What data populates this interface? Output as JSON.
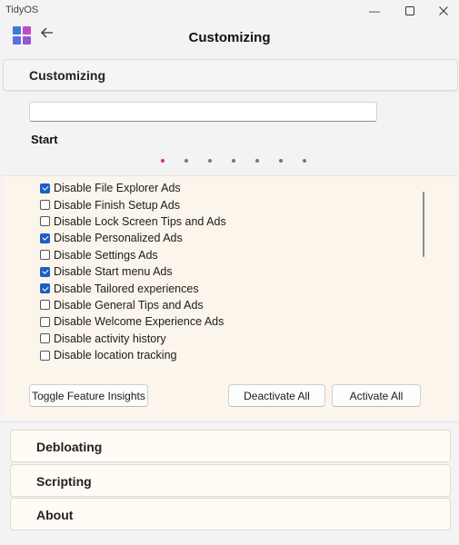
{
  "window": {
    "title": "TidyOS",
    "controls": {
      "minimize_icon": "minimize-icon",
      "maximize_icon": "maximize-icon",
      "close_icon": "close-icon"
    }
  },
  "header": {
    "title": "Customizing",
    "back_icon": "back-arrow-icon",
    "logo_colors": [
      "#3e7bd8",
      "#c24bc6",
      "#5a6ee0",
      "#8e5ad0"
    ]
  },
  "expander": {
    "label": "Customizing"
  },
  "search": {
    "value": "",
    "placeholder": ""
  },
  "section": {
    "title": "Start"
  },
  "pager": {
    "count": 7,
    "active_index": 0,
    "active_color": "#e0208e",
    "inactive_color": "#777777"
  },
  "features": [
    {
      "label": "Disable File Explorer Ads",
      "checked": true
    },
    {
      "label": "Disable Finish Setup Ads",
      "checked": false
    },
    {
      "label": "Disable Lock Screen Tips and Ads",
      "checked": false
    },
    {
      "label": "Disable Personalized Ads",
      "checked": true
    },
    {
      "label": "Disable Settings Ads",
      "checked": false
    },
    {
      "label": "Disable Start menu Ads",
      "checked": true
    },
    {
      "label": "Disable Tailored experiences",
      "checked": true
    },
    {
      "label": "Disable General Tips and Ads",
      "checked": false
    },
    {
      "label": "Disable Welcome Experience Ads",
      "checked": false
    },
    {
      "label": "Disable activity history",
      "checked": false
    },
    {
      "label": "Disable location tracking",
      "checked": false
    }
  ],
  "buttons": {
    "toggle_insights": "Toggle Feature Insights",
    "deactivate_all": "Deactivate All",
    "activate_all": "Activate All"
  },
  "sections": [
    {
      "label": "Debloating"
    },
    {
      "label": "Scripting"
    },
    {
      "label": "About"
    }
  ],
  "colors": {
    "accent": "#1a5fc6",
    "panel_bg": "#fbf5ec",
    "card_bg": "#fffbf5"
  }
}
